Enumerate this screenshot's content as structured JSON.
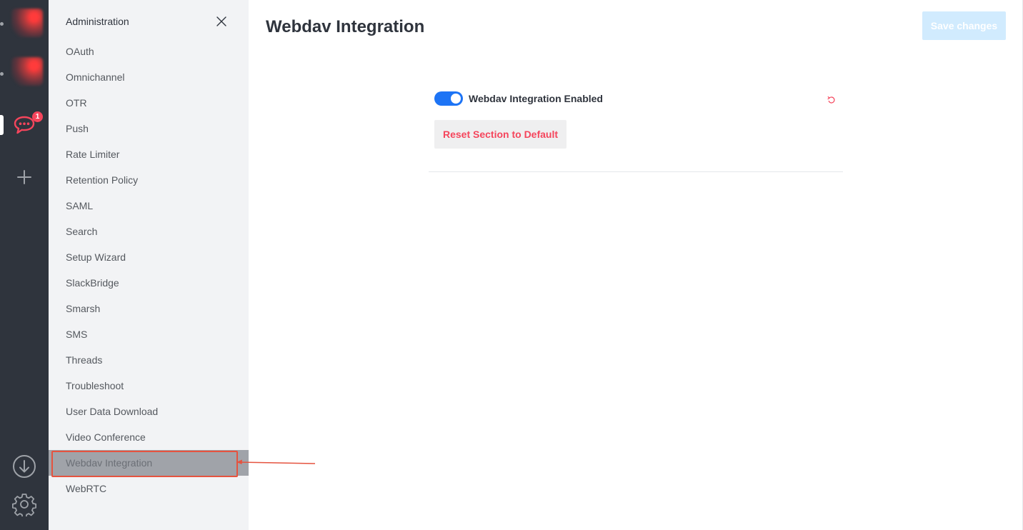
{
  "rail": {
    "badge_count": "1",
    "icons": [
      "server-thumbnail",
      "server-thumbnail",
      "chat-bubble-icon",
      "plus-icon",
      "download-icon",
      "gear-icon"
    ]
  },
  "sidebar": {
    "title": "Administration",
    "items": [
      {
        "label": "OAuth"
      },
      {
        "label": "Omnichannel"
      },
      {
        "label": "OTR"
      },
      {
        "label": "Push"
      },
      {
        "label": "Rate Limiter"
      },
      {
        "label": "Retention Policy"
      },
      {
        "label": "SAML"
      },
      {
        "label": "Search"
      },
      {
        "label": "Setup Wizard"
      },
      {
        "label": "SlackBridge"
      },
      {
        "label": "Smarsh"
      },
      {
        "label": "SMS"
      },
      {
        "label": "Threads"
      },
      {
        "label": "Troubleshoot"
      },
      {
        "label": "User Data Download"
      },
      {
        "label": "Video Conference"
      },
      {
        "label": "Webdav Integration"
      },
      {
        "label": "WebRTC"
      }
    ],
    "selected_index": 16
  },
  "main": {
    "title": "Webdav Integration",
    "save_label": "Save changes",
    "setting": {
      "label": "Webdav Integration Enabled",
      "enabled": true
    },
    "reset_section_label": "Reset Section to Default"
  },
  "colors": {
    "accent": "#1d74f5",
    "danger": "#f5455c",
    "rail_bg": "#2f343d",
    "sidebar_bg": "#f2f3f5",
    "annotation": "#e5533f"
  }
}
